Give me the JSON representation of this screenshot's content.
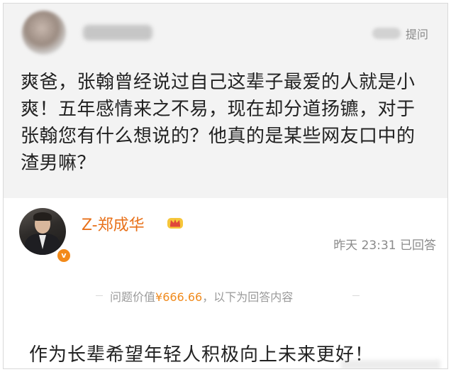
{
  "question": {
    "ask_link": "提问",
    "text": "爽爸，张翰曾经说过自己这辈子最爱的人就是小爽！五年感情来之不易，现在却分道扬镳，对于张翰您有什么想说的？他真的是某些网友口中的渣男嘛？"
  },
  "answer": {
    "answerer_name": "Z-郑成华",
    "time": "昨天 23:31 已回答",
    "price_prefix": "问题价值",
    "price_amount": "¥666.66",
    "price_suffix": "，以下为回答内容",
    "text": "作为长辈希望年轻人积极向上未来更好！"
  },
  "colors": {
    "accent": "#e8711a",
    "question_bg": "#f3f3f3"
  },
  "icons": [
    "crown-icon",
    "verified-icon"
  ]
}
